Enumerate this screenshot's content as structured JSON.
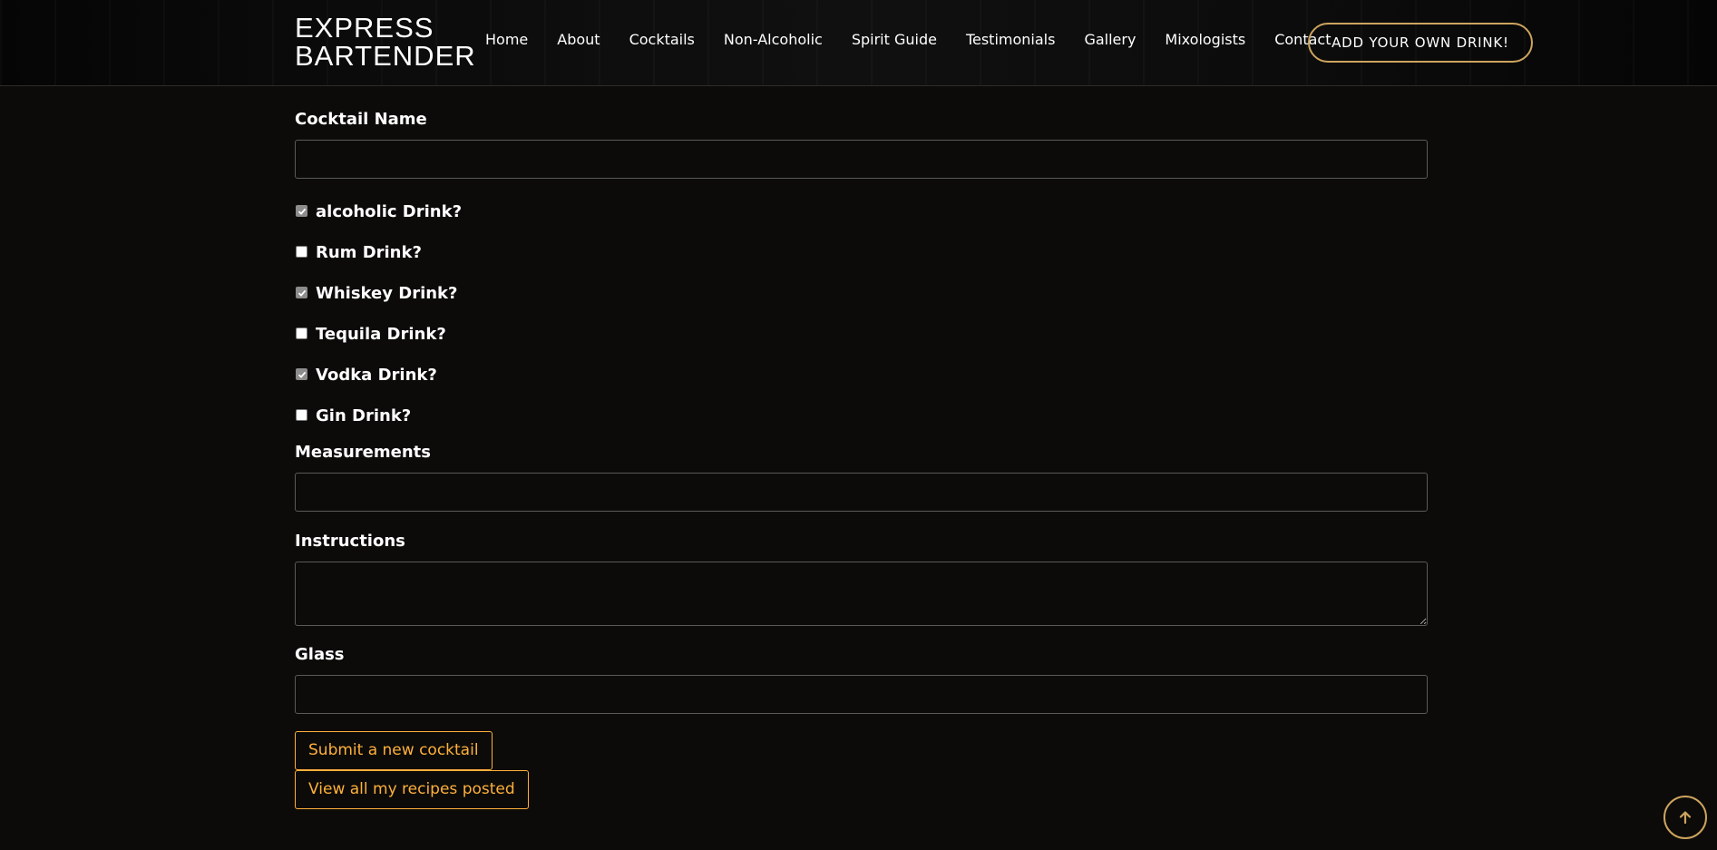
{
  "brand": {
    "line1": "EXPRESS",
    "line2": "BARTENDER"
  },
  "nav": {
    "items": [
      "Home",
      "About",
      "Cocktails",
      "Non-Alcoholic",
      "Spirit Guide",
      "Testimonials",
      "Gallery",
      "Mixologists",
      "Contact"
    ],
    "cta_label": "ADD YOUR OWN DRINK!"
  },
  "form": {
    "name_label": "Cocktail Name",
    "name_value": "",
    "checkboxes": [
      {
        "label": "alcoholic Drink?",
        "checked": true
      },
      {
        "label": "Rum Drink?",
        "checked": false
      },
      {
        "label": "Whiskey Drink?",
        "checked": true
      },
      {
        "label": "Tequila Drink?",
        "checked": false
      },
      {
        "label": "Vodka Drink?",
        "checked": true
      },
      {
        "label": "Gin Drink?",
        "checked": false
      }
    ],
    "measurements_label": "Measurements",
    "measurements_value": "",
    "instructions_label": "Instructions",
    "instructions_value": "",
    "glass_label": "Glass",
    "glass_value": "",
    "submit_label": "Submit a new cocktail",
    "view_label": "View all my recipes posted"
  },
  "icons": {
    "scroll_top": "arrow-up-icon",
    "check": "checkmark-icon"
  },
  "colors": {
    "accent": "#cda45e",
    "button": "#ffb03b",
    "background": "#0c0b09"
  }
}
